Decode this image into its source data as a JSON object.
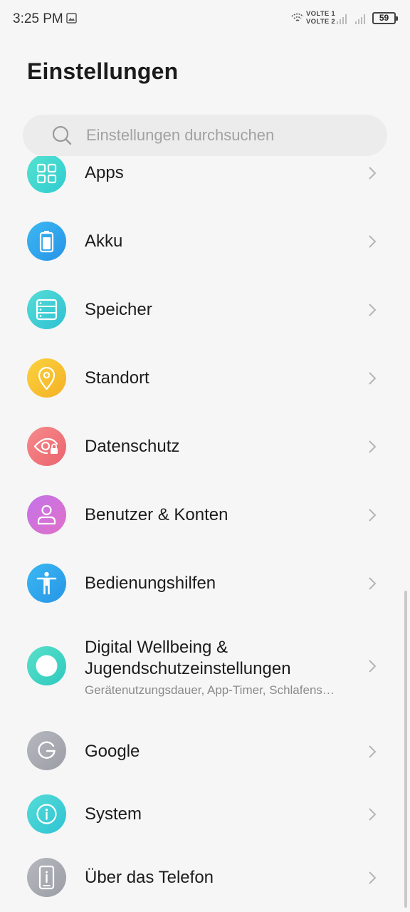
{
  "status_bar": {
    "time": "3:25 PM",
    "volte_1": "VOLTE",
    "volte_2": "VOLTE",
    "battery": "59"
  },
  "header": {
    "title": "Einstellungen"
  },
  "search": {
    "placeholder": "Einstellungen durchsuchen"
  },
  "items": [
    {
      "label": "Apps",
      "icon": "apps-icon",
      "color": "#3ed6c8"
    },
    {
      "label": "Akku",
      "icon": "battery-icon",
      "color": "#2ea6ef"
    },
    {
      "label": "Speicher",
      "icon": "storage-icon",
      "color": "#3ecfd0"
    },
    {
      "label": "Standort",
      "icon": "location-icon",
      "color": "#f7c531"
    },
    {
      "label": "Datenschutz",
      "icon": "privacy-icon",
      "color": "#f07a7e"
    },
    {
      "label": "Benutzer & Konten",
      "icon": "user-icon",
      "color": "#b461e6"
    },
    {
      "label": "Bedienungshilfen",
      "icon": "accessibility-icon",
      "color": "#2fa8ee"
    },
    {
      "label_line1": "Digital Wellbeing &",
      "label_line2": "Jugendschutzeinstellungen",
      "subtitle": "Gerätenutzungsdauer, App-Timer, Schlafens…",
      "icon": "wellbeing-icon",
      "color": "#3ed6c0"
    },
    {
      "label": "Google",
      "icon": "google-icon",
      "color": "#a7a9b1"
    },
    {
      "label": "System",
      "icon": "info-icon",
      "color": "#3ecfd6"
    },
    {
      "label": "Über das Telefon",
      "icon": "phone-icon",
      "color": "#a7a9b1"
    }
  ]
}
